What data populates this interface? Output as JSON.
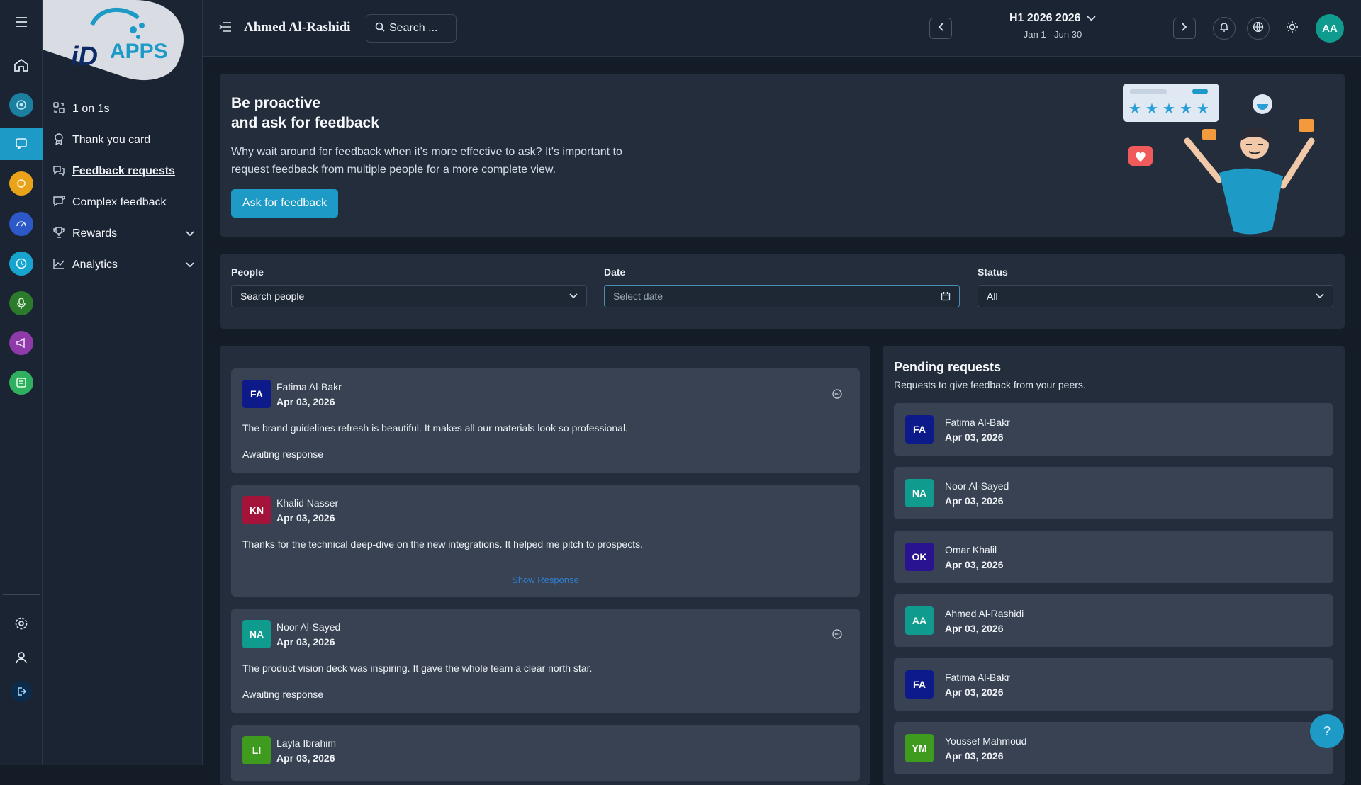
{
  "app": {
    "logo_text": "APPS"
  },
  "rail": {
    "items": [
      {
        "icon": "home-icon"
      },
      {
        "icon": "target-icon"
      },
      {
        "icon": "feedback-icon"
      },
      {
        "icon": "coins-icon"
      },
      {
        "icon": "gauge-icon"
      },
      {
        "icon": "clock-icon"
      },
      {
        "icon": "microphone-icon"
      },
      {
        "icon": "megaphone-icon"
      },
      {
        "icon": "board-icon"
      }
    ],
    "bottom": [
      {
        "icon": "gear-icon"
      },
      {
        "icon": "user-icon"
      },
      {
        "icon": "logout-icon"
      }
    ]
  },
  "sidebar": {
    "items": [
      {
        "label": "1 on 1s",
        "icon": "meeting-icon"
      },
      {
        "label": "Thank you card",
        "icon": "award-icon"
      },
      {
        "label": "Feedback requests",
        "icon": "request-icon"
      },
      {
        "label": "Complex feedback",
        "icon": "chat-icon"
      },
      {
        "label": "Rewards",
        "icon": "trophy-icon"
      },
      {
        "label": "Analytics",
        "icon": "chart-icon"
      }
    ]
  },
  "topbar": {
    "user_name": "Ahmed Al-Rashidi",
    "search_placeholder": "Search ...",
    "period_title": "H1 2026 2026",
    "period_range": "Jan 1 - Jun 30",
    "avatar_initials": "AA"
  },
  "hero": {
    "title_line1": "Be proactive",
    "title_line2": "and ask for feedback",
    "description": "Why wait around for feedback when it's more effective to ask? It's important to request feedback from multiple people for a more complete view.",
    "button_label": "Ask for feedback"
  },
  "filters": {
    "people_label": "People",
    "people_value": "Search people",
    "date_label": "Date",
    "date_placeholder": "Select date",
    "status_label": "Status",
    "status_value": "All"
  },
  "feed": {
    "items": [
      {
        "initials": "FA",
        "name": "Fatima Al-Bakr",
        "date": "Apr 03, 2026",
        "message": "The brand guidelines refresh is beautiful. It makes all our materials look so professional.",
        "status": "Awaiting response",
        "color": "#0d1a8a"
      },
      {
        "initials": "KN",
        "name": "Khalid Nasser",
        "date": "Apr 03, 2026",
        "message": "Thanks for the technical deep-dive on the new integrations. It helped me pitch to prospects.",
        "link": "Show Response",
        "color": "#a3133a"
      },
      {
        "initials": "NA",
        "name": "Noor Al-Sayed",
        "date": "Apr 03, 2026",
        "message": "The product vision deck was inspiring. It gave the whole team a clear north star.",
        "status": "Awaiting response",
        "color": "#0f9c8f"
      },
      {
        "initials": "LI",
        "name": "Layla Ibrahim",
        "date": "Apr 03, 2026",
        "color": "#3f9b1e"
      }
    ]
  },
  "pending": {
    "title": "Pending requests",
    "subtitle": "Requests to give feedback from your peers.",
    "items": [
      {
        "initials": "FA",
        "name": "Fatima Al-Bakr",
        "date": "Apr 03, 2026",
        "color": "#0d1a8a"
      },
      {
        "initials": "NA",
        "name": "Noor Al-Sayed",
        "date": "Apr 03, 2026",
        "color": "#0f9c8f"
      },
      {
        "initials": "OK",
        "name": "Omar Khalil",
        "date": "Apr 03, 2026",
        "color": "#2a138f"
      },
      {
        "initials": "AA",
        "name": "Ahmed Al-Rashidi",
        "date": "Apr 03, 2026",
        "color": "#0f9c8f"
      },
      {
        "initials": "FA",
        "name": "Fatima Al-Bakr",
        "date": "Apr 03, 2026",
        "color": "#0d1a8a"
      },
      {
        "initials": "YM",
        "name": "Youssef Mahmoud",
        "date": "Apr 03, 2026",
        "color": "#3f9b1e"
      }
    ]
  },
  "help": {
    "label": "?"
  }
}
